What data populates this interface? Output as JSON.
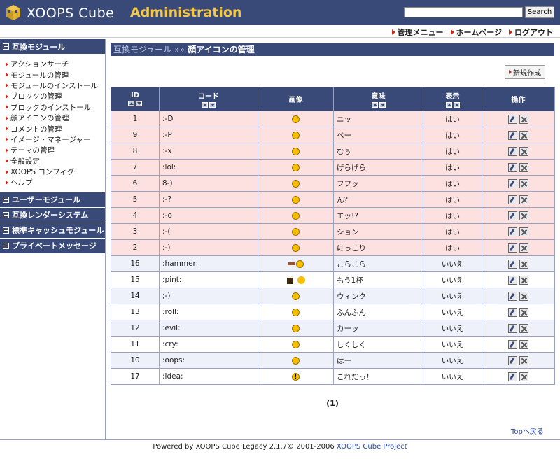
{
  "header": {
    "logo_text": "XOOPS Cube",
    "admin_text": "Administration",
    "search_placeholder": "",
    "search_button": "Search"
  },
  "topnav": {
    "links": [
      "管理メニュー",
      "ホームページ",
      "ログアウト"
    ]
  },
  "sidebar": {
    "blocks": [
      {
        "title": "互換モジュール",
        "expanded": true,
        "items": [
          "アクションサーチ",
          "モジュールの管理",
          "モジュールのインストール",
          "ブロックの管理",
          "ブロックのインストール",
          "顔アイコンの管理",
          "コメントの管理",
          "イメージ・マネージャー",
          "テーマの管理",
          "全般設定",
          "XOOPS コンフィグ",
          "ヘルプ"
        ]
      },
      {
        "title": "ユーザーモジュール",
        "expanded": false
      },
      {
        "title": "互換レンダーシステム",
        "expanded": false
      },
      {
        "title": "標準キャッシュモジュール",
        "expanded": false
      },
      {
        "title": "プライベートメッセージ",
        "expanded": false
      }
    ]
  },
  "main": {
    "breadcrumb_module": "互換モジュール",
    "breadcrumb_sep": "»»",
    "page_title": "顔アイコンの管理",
    "create_button": "新規作成",
    "columns": [
      "ID",
      "コード",
      "画像",
      "意味",
      "表示",
      "操作"
    ],
    "rows": [
      {
        "id": "1",
        "code": ":-D",
        "meaning": "ニッ",
        "display": "はい",
        "icon": "grin-icon"
      },
      {
        "id": "9",
        "code": ":-P",
        "meaning": "ベー",
        "display": "はい",
        "icon": "tongue-icon"
      },
      {
        "id": "8",
        "code": ":-x",
        "meaning": "むぅ",
        "display": "はい",
        "icon": "mad-icon"
      },
      {
        "id": "7",
        "code": ":lol:",
        "meaning": "げらげら",
        "display": "はい",
        "icon": "lol-icon"
      },
      {
        "id": "6",
        "code": "8-)",
        "meaning": "フフッ",
        "display": "はい",
        "icon": "cool-icon"
      },
      {
        "id": "5",
        "code": ":-?",
        "meaning": "ん？",
        "display": "はい",
        "icon": "confused-icon"
      },
      {
        "id": "4",
        "code": ":-o",
        "meaning": "エッ!?",
        "display": "はい",
        "icon": "surprised-icon"
      },
      {
        "id": "3",
        "code": ":-(",
        "meaning": "ション",
        "display": "はい",
        "icon": "sad-icon"
      },
      {
        "id": "2",
        "code": ":-)",
        "meaning": "にっこり",
        "display": "はい",
        "icon": "smile-icon"
      },
      {
        "id": "16",
        "code": ":hammer:",
        "meaning": "こらこら",
        "display": "いいえ",
        "icon": "hammer-icon"
      },
      {
        "id": "15",
        "code": ":pint:",
        "meaning": "もう1杯",
        "display": "いいえ",
        "icon": "pint-icon"
      },
      {
        "id": "14",
        "code": ";-)",
        "meaning": "ウィンク",
        "display": "いいえ",
        "icon": "wink-icon"
      },
      {
        "id": "13",
        "code": ":roll:",
        "meaning": "ふんふん",
        "display": "いいえ",
        "icon": "roll-icon"
      },
      {
        "id": "12",
        "code": ":evil:",
        "meaning": "カーッ",
        "display": "いいえ",
        "icon": "evil-icon"
      },
      {
        "id": "11",
        "code": ":cry:",
        "meaning": "しくしく",
        "display": "いいえ",
        "icon": "cry-icon"
      },
      {
        "id": "10",
        "code": ":oops:",
        "meaning": "はー",
        "display": "いいえ",
        "icon": "oops-icon"
      },
      {
        "id": "17",
        "code": ":idea:",
        "meaning": "これだっ！",
        "display": "いいえ",
        "icon": "idea-icon"
      }
    ],
    "pager": "(1)",
    "top_link": "Topへ戻る"
  },
  "footer": {
    "text": "Powered by XOOPS Cube Legacy 2.1.7© 2001-2006",
    "link": "XOOPS Cube Project"
  },
  "colors": {
    "header_bg": "#3a4a78",
    "accent_yellow": "#f2c94c",
    "row_on_bg": "#fde0e0",
    "row_off_alt_bg": "#eef0fa"
  }
}
